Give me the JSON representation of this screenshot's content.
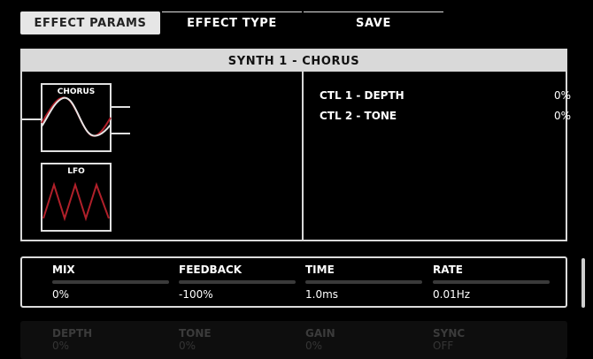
{
  "tabs": [
    {
      "label": "EFFECT PARAMS",
      "active": true
    },
    {
      "label": "EFFECT TYPE",
      "active": false
    },
    {
      "label": "SAVE",
      "active": false
    }
  ],
  "panel": {
    "title": "SYNTH 1 - CHORUS",
    "diagram": {
      "chorus_label": "CHORUS",
      "lfo_label": "LFO"
    },
    "controls": [
      {
        "label": "CTL 1  -  DEPTH",
        "value": "0%"
      },
      {
        "label": "CTL 2  -  TONE",
        "value": "0%"
      }
    ]
  },
  "params": [
    {
      "label": "MIX",
      "value": "0%",
      "level": 0.0
    },
    {
      "label": "FEEDBACK",
      "value": "-100%",
      "level": 0.0
    },
    {
      "label": "TIME",
      "value": "1.0ms",
      "level": 0.0
    },
    {
      "label": "RATE",
      "value": "0.01Hz",
      "level": 0.0
    }
  ],
  "params_next": [
    {
      "label": "DEPTH",
      "value": "0%"
    },
    {
      "label": "TONE",
      "value": "0%"
    },
    {
      "label": "GAIN",
      "value": "0%"
    },
    {
      "label": "SYNC",
      "value": "OFF"
    }
  ],
  "colors": {
    "accent_red": "#b0202a",
    "panel_border": "#d8d8d8"
  }
}
